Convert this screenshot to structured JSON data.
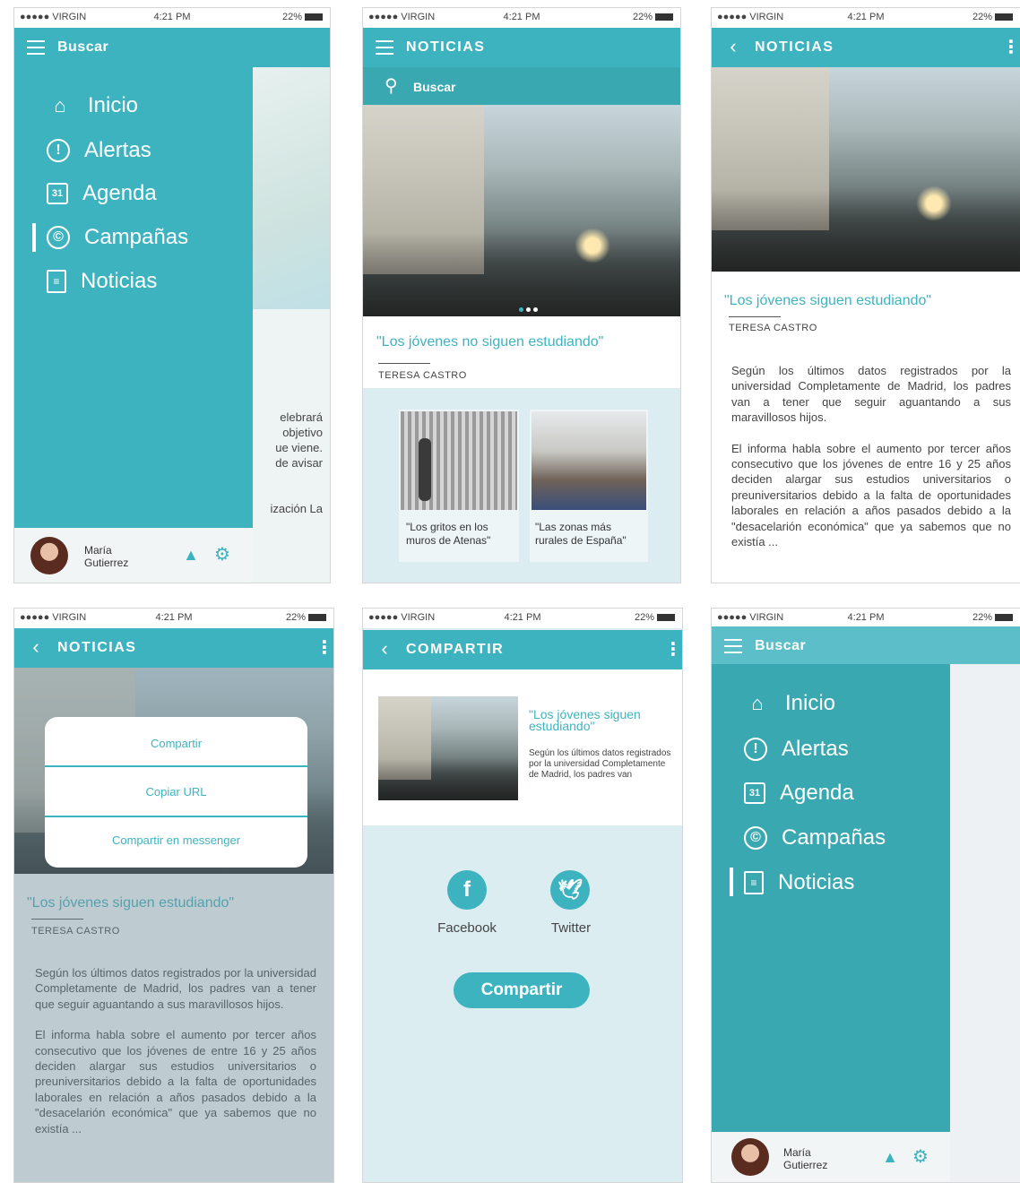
{
  "status": {
    "carrier": "●●●●● VIRGIN",
    "time": "4:21 PM",
    "battery": "22%"
  },
  "colors": {
    "accent": "#3eb3c0",
    "accent_dark": "#3aa8b1",
    "light_bg": "#dcedf2"
  },
  "menu": {
    "search_title": "Buscar",
    "items": [
      {
        "label": "Inicio",
        "icon": "home-icon"
      },
      {
        "label": "Alertas",
        "icon": "alert-icon"
      },
      {
        "label": "Agenda",
        "icon": "calendar-icon"
      },
      {
        "label": "Campañas",
        "icon": "campaign-icon"
      },
      {
        "label": "Noticias",
        "icon": "news-icon"
      }
    ],
    "calendar_day": "31",
    "user": {
      "first_name": "María",
      "last_name": "Gutierrez"
    },
    "behind_text": [
      "elebrará",
      "objetivo",
      "ue viene.",
      "de avisar",
      "ización La"
    ]
  },
  "news_list": {
    "title": "NOTICIAS",
    "search": "Buscar",
    "headline": "\"Los jóvenes no siguen estudiando\"",
    "author": "TERESA CASTRO",
    "cards": [
      {
        "caption": "\"Los gritos en los muros de Atenas\""
      },
      {
        "caption": "\"Las zonas más rurales de España\""
      }
    ]
  },
  "article": {
    "title": "NOTICIAS",
    "headline": "\"Los jóvenes siguen estudiando\"",
    "author": "TERESA CASTRO",
    "paragraphs": [
      "Según los últimos datos registrados por la universidad Completamente de Madrid, los padres van a tener que seguir aguantando a sus maravillosos hijos.",
      "El informa habla sobre el aumento por tercer años consecutivo que los jóvenes de entre 16 y 25 años deciden alargar sus estudios universitarios o preuniversitarios debido a la falta de oportunidades laborales en relación a años pasados debido a la \"desacelarión económica\" que ya sabemos que no existía ..."
    ]
  },
  "share_dialog": {
    "options": [
      "Compartir",
      "Copiar URL",
      "Compartir en messenger"
    ]
  },
  "share_screen": {
    "title": "COMPARTIR",
    "preview_headline": "\"Los jóvenes siguen estudiando\"",
    "preview_text": "Según los últimos datos registrados por la universidad Completamente de Madrid, los padres van",
    "facebook": "Facebook",
    "twitter": "Twitter",
    "facebook_glyph": "f",
    "button": "Compartir"
  }
}
